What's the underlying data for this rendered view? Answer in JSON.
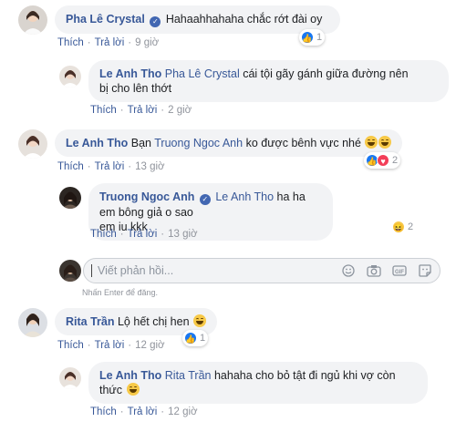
{
  "actions": {
    "like": "Thích",
    "reply": "Trả lời"
  },
  "reply_input": {
    "placeholder": "Viết phản hồi...",
    "hint": "Nhấn Enter để đăng."
  },
  "comments": [
    {
      "author": "Pha Lê Crystal",
      "text": "Hahaahhahaha chắc rớt đài oy",
      "time": "9 giờ",
      "reactions": "1"
    },
    {
      "author": "Le Anh Tho",
      "tag": "Pha Lê Crystal",
      "text": " cái tội gãy gánh giữa đường nên",
      "text2": "bị cho lên thớt",
      "time": "2 giờ"
    },
    {
      "author": "Le Anh Tho",
      "tag": "Bạn",
      "tag_name": "Truong Ngoc Anh",
      "text": " ko được bênh vực nhé",
      "time": "13 giờ",
      "reactions": "2"
    },
    {
      "author": "Truong Ngoc Anh",
      "tag": "Le Anh Tho",
      "text": " ha ha em bông giả o sao",
      "text2": "em iu kkk",
      "time": "13 giờ",
      "reactions": "2"
    },
    {
      "author": "Rita Trần",
      "text": "Lộ hết chị hen",
      "time": "12 giờ",
      "reactions": "1"
    },
    {
      "author": "Le Anh Tho",
      "tag": "Rita Trần",
      "text": " hahaha cho bỏ tật đi ngủ khi vợ còn",
      "text2": "thức",
      "time": "12 giờ"
    }
  ],
  "colors": {
    "link": "#385898",
    "bubble": "#f2f3f5",
    "like": "#1877f2",
    "love": "#f33e58",
    "haha": "#f7c948"
  }
}
